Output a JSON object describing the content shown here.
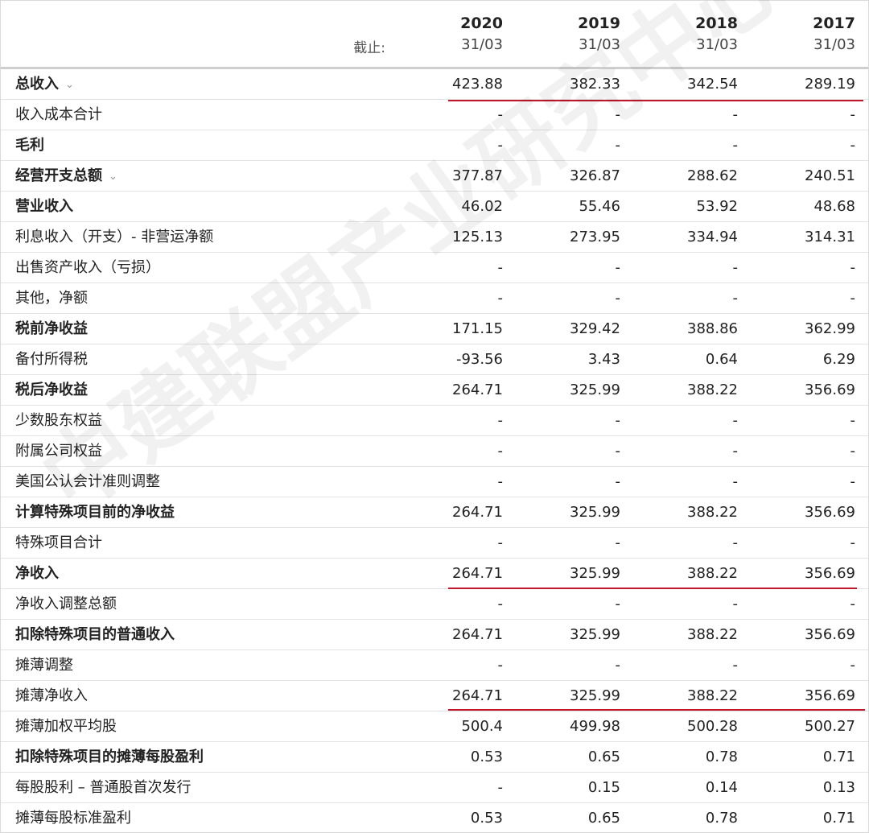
{
  "header": {
    "label": "截止:",
    "columns": [
      {
        "year": "2020",
        "date": "31/03"
      },
      {
        "year": "2019",
        "date": "31/03"
      },
      {
        "year": "2018",
        "date": "31/03"
      },
      {
        "year": "2017",
        "date": "31/03"
      }
    ]
  },
  "rows": [
    {
      "label": "总收入",
      "values": [
        "423.88",
        "382.33",
        "342.54",
        "289.19"
      ]
    },
    {
      "label": "收入成本合计",
      "values": [
        "-",
        "-",
        "-",
        "-"
      ]
    },
    {
      "label": "毛利",
      "values": [
        "-",
        "-",
        "-",
        "-"
      ]
    },
    {
      "label": "经营开支总额",
      "values": [
        "377.87",
        "326.87",
        "288.62",
        "240.51"
      ]
    },
    {
      "label": "营业收入",
      "values": [
        "46.02",
        "55.46",
        "53.92",
        "48.68"
      ]
    },
    {
      "label": "利息收入（开支）- 非营运净额",
      "values": [
        "125.13",
        "273.95",
        "334.94",
        "314.31"
      ]
    },
    {
      "label": "出售资产收入（亏损）",
      "values": [
        "-",
        "-",
        "-",
        "-"
      ]
    },
    {
      "label": "其他，净额",
      "values": [
        "-",
        "-",
        "-",
        "-"
      ]
    },
    {
      "label": "税前净收益",
      "values": [
        "171.15",
        "329.42",
        "388.86",
        "362.99"
      ]
    },
    {
      "label": "备付所得税",
      "values": [
        "-93.56",
        "3.43",
        "0.64",
        "6.29"
      ]
    },
    {
      "label": "税后净收益",
      "values": [
        "264.71",
        "325.99",
        "388.22",
        "356.69"
      ]
    },
    {
      "label": "少数股东权益",
      "values": [
        "-",
        "-",
        "-",
        "-"
      ]
    },
    {
      "label": "附属公司权益",
      "values": [
        "-",
        "-",
        "-",
        "-"
      ]
    },
    {
      "label": "美国公认会计准则调整",
      "values": [
        "-",
        "-",
        "-",
        "-"
      ]
    },
    {
      "label": "计算特殊项目前的净收益",
      "values": [
        "264.71",
        "325.99",
        "388.22",
        "356.69"
      ]
    },
    {
      "label": "特殊项目合计",
      "values": [
        "-",
        "-",
        "-",
        "-"
      ]
    },
    {
      "label": "净收入",
      "values": [
        "264.71",
        "325.99",
        "388.22",
        "356.69"
      ]
    },
    {
      "label": "净收入调整总额",
      "values": [
        "-",
        "-",
        "-",
        "-"
      ]
    },
    {
      "label": "扣除特殊项目的普通收入",
      "values": [
        "264.71",
        "325.99",
        "388.22",
        "356.69"
      ]
    },
    {
      "label": "摊薄调整",
      "values": [
        "-",
        "-",
        "-",
        "-"
      ]
    },
    {
      "label": "摊薄净收入",
      "values": [
        "264.71",
        "325.99",
        "388.22",
        "356.69"
      ]
    },
    {
      "label": "摊薄加权平均股",
      "values": [
        "500.4",
        "499.98",
        "500.28",
        "500.27"
      ]
    },
    {
      "label": "扣除特殊项目的摊薄每股盈利",
      "values": [
        "0.53",
        "0.65",
        "0.78",
        "0.71"
      ]
    },
    {
      "label": "每股股利 – 普通股首次发行",
      "values": [
        "-",
        "0.15",
        "0.14",
        "0.13"
      ]
    },
    {
      "label": "摊薄每股标准盈利",
      "values": [
        "0.53",
        "0.65",
        "0.78",
        "0.71"
      ]
    }
  ],
  "watermark": "中建联盟产业研究中心",
  "colors": {
    "underline": "#c0172a",
    "header_rule": "#cfcfcf",
    "row_rule": "#e2e2e2"
  }
}
